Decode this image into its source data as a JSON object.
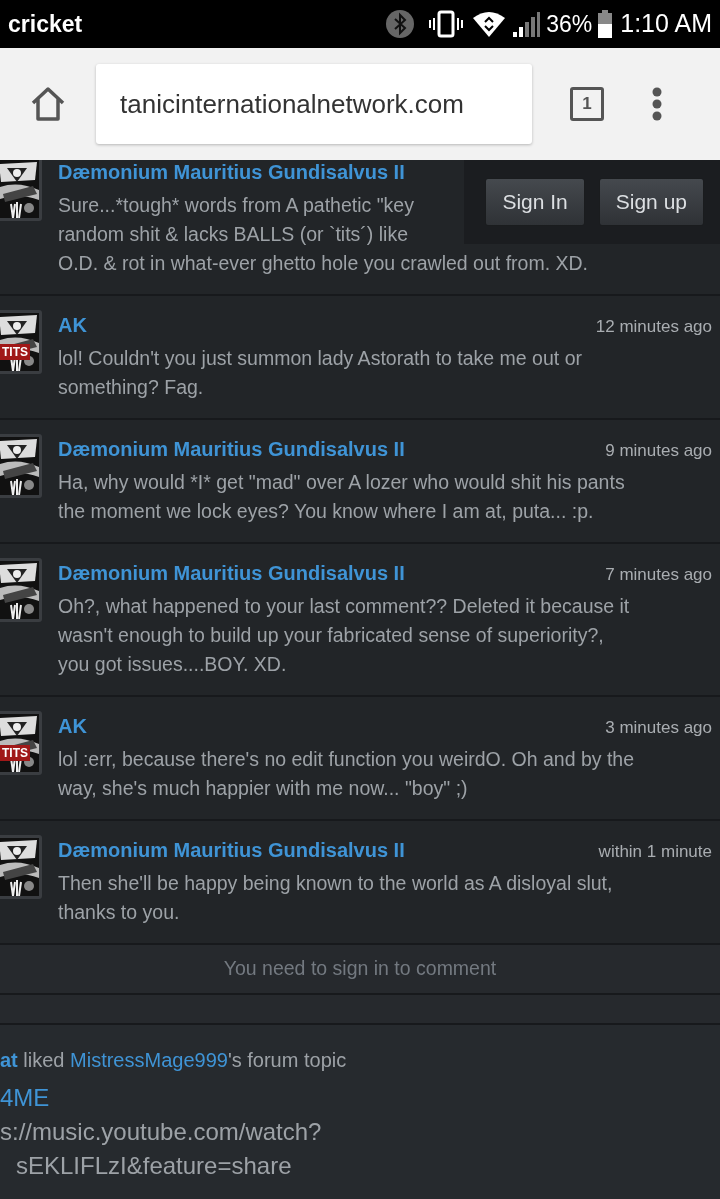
{
  "status_bar": {
    "carrier": "cricket",
    "battery_percent": "36%",
    "time": "1:10 AM"
  },
  "browser": {
    "url": "tanicinternationalnetwork.com",
    "tab_count": "1"
  },
  "auth_buttons": [
    "Sign In",
    "Sign up"
  ],
  "comments": [
    {
      "author": "Dæmonium Mauritius Gundisalvus II",
      "body_lines": [
        "Sure...*tough* words from A pathetic \"key",
        "random shit & lacks BALLS (or `tits´) like",
        "O.D. & rot in what-ever ghetto hole you crawled out from. XD."
      ]
    },
    {
      "author": "AK",
      "time": "12 minutes ago",
      "badge": "TITS",
      "body_lines": [
        "lol! Couldn't you just summon lady Astorath to take me out or",
        "something? Fag."
      ]
    },
    {
      "author": "Dæmonium Mauritius Gundisalvus II",
      "time": "9 minutes ago",
      "body_lines": [
        "Ha, why would *I* get \"mad\" over A lozer who would shit his pants",
        "the moment we lock eyes? You know where I am at, puta... :p."
      ]
    },
    {
      "author": "Dæmonium Mauritius Gundisalvus II",
      "time": "7 minutes ago",
      "body_lines": [
        "Oh?, what happened to your last comment?? Deleted it because it",
        "wasn't enough to build up your fabricated sense of superiority?,",
        "you got issues....BOY. XD."
      ]
    },
    {
      "author": "AK",
      "time": "3 minutes ago",
      "badge": "TITS",
      "body_lines": [
        "lol :err, because there's no edit function you weirdO. Oh and by the",
        "way, she's much happier with me now... \"boy\" ;)"
      ]
    },
    {
      "author": "Dæmonium Mauritius Gundisalvus II",
      "time": "within 1 minute",
      "body_lines": [
        "Then she'll be happy being known to the world as A disloyal slut,",
        "thanks to you."
      ]
    }
  ],
  "sign_in_notice": "You need to sign in to comment",
  "activity": {
    "actor": "at",
    "verb": " liked ",
    "target": "MistressMage999",
    "suffix": "'s forum topic",
    "topic": "4ME",
    "body_lines": [
      "s://music.youtube.com/watch?",
      "sEKLIFLzI&feature=share"
    ]
  }
}
